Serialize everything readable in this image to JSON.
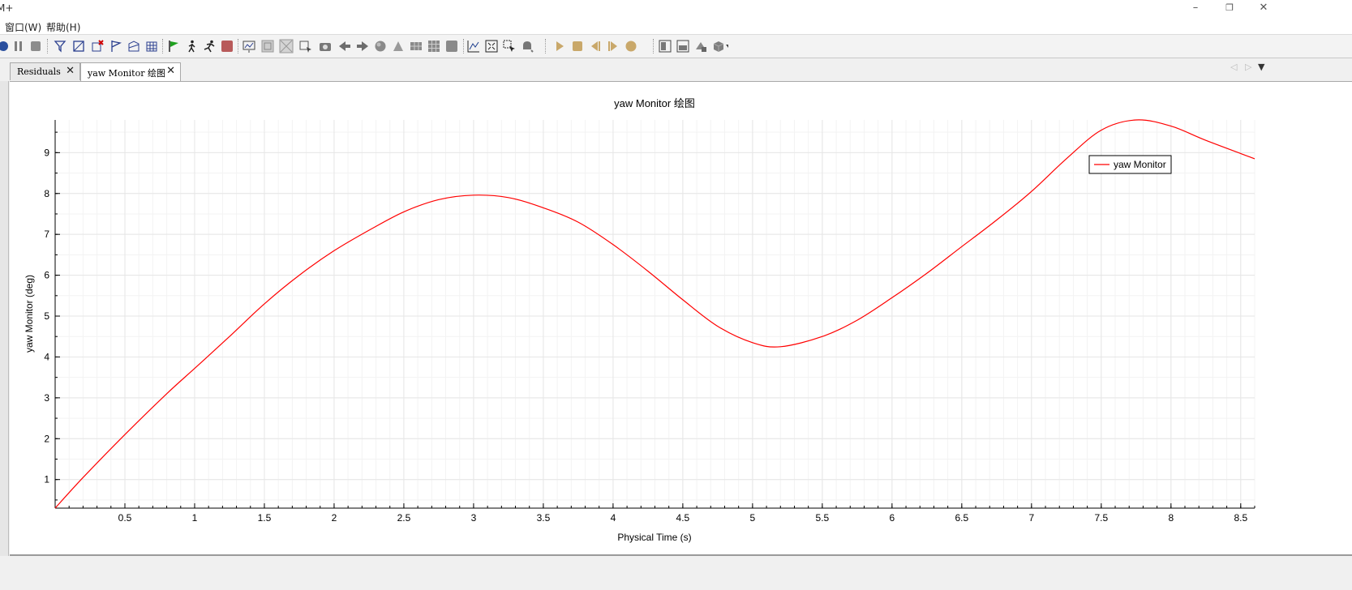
{
  "window": {
    "title": "M+",
    "minimize_label": "–",
    "restore_label": "❐",
    "close_label": "✕"
  },
  "menu": {
    "items": [
      {
        "label": "窗口(W)"
      },
      {
        "label": "帮助(H)"
      }
    ]
  },
  "toolbar": {
    "icons": [
      "record-icon",
      "pause-icon",
      "stop-icon",
      "filter-icon",
      "scene-icon",
      "delete-plot-icon",
      "flag-outline-icon",
      "plot-3d-icon",
      "mesh-icon",
      "run-flag-icon",
      "step-icon",
      "run-icon",
      "stop-run-icon",
      "image-icon",
      "grid-fit-icon",
      "zoom-icon",
      "select-icon",
      "camera-icon",
      "back-icon",
      "forward-icon",
      "sphere-icon",
      "probe-icon",
      "table-icon",
      "grid-icon",
      "box-icon",
      "plot-points-icon",
      "fit-icon",
      "cursor-icon",
      "bell-icon",
      "play-icon",
      "stop-anim-icon",
      "prev-frame-icon",
      "next-frame-icon",
      "record-anim-icon",
      "layout-icon",
      "layout2-icon",
      "view-icon",
      "cube-icon"
    ]
  },
  "tabs": [
    {
      "label": "Residuals",
      "close": "✕"
    },
    {
      "label": "yaw Monitor 绘图",
      "close": "✕"
    }
  ],
  "nav": {
    "left": "◁",
    "right": "▷",
    "menu": "▼"
  },
  "colors": {
    "series": "#ff0000",
    "grid": "#e6e6e6",
    "axis": "#000000"
  },
  "chart_data": {
    "type": "line",
    "title": "yaw Monitor 绘图",
    "xlabel": "Physical Time (s)",
    "ylabel": "yaw Monitor (deg)",
    "xlim": [
      0,
      8.6
    ],
    "ylim": [
      0.3,
      9.8
    ],
    "xticks": [
      0.5,
      1,
      1.5,
      2,
      2.5,
      3,
      3.5,
      4,
      4.5,
      5,
      5.5,
      6,
      6.5,
      7,
      7.5,
      8,
      8.5
    ],
    "xtick_labels": [
      "0.5",
      "1",
      "1.5",
      "2",
      "2.5",
      "3",
      "3.5",
      "4",
      "4.5",
      "5",
      "5.5",
      "6",
      "6.5",
      "7",
      "7.5",
      "8",
      "8.5"
    ],
    "yticks": [
      1,
      2,
      3,
      4,
      5,
      6,
      7,
      8,
      9
    ],
    "ytick_labels": [
      "1",
      "2",
      "3",
      "4",
      "5",
      "6",
      "7",
      "8",
      "9"
    ],
    "grid": true,
    "legend": {
      "position": "top-right",
      "entries": [
        "yaw Monitor"
      ]
    },
    "series": [
      {
        "name": "yaw Monitor",
        "color": "#ff0000",
        "x": [
          0.0,
          0.2,
          0.5,
          0.8,
          1.0,
          1.25,
          1.5,
          1.75,
          2.0,
          2.25,
          2.5,
          2.75,
          3.0,
          3.25,
          3.5,
          3.75,
          4.0,
          4.25,
          4.5,
          4.75,
          5.0,
          5.2,
          5.5,
          5.75,
          6.0,
          6.25,
          6.5,
          6.75,
          7.0,
          7.25,
          7.5,
          7.75,
          8.0,
          8.25,
          8.6
        ],
        "y": [
          0.3,
          1.05,
          2.1,
          3.1,
          3.72,
          4.5,
          5.3,
          6.0,
          6.6,
          7.1,
          7.55,
          7.85,
          7.96,
          7.9,
          7.65,
          7.3,
          6.75,
          6.1,
          5.4,
          4.75,
          4.35,
          4.25,
          4.5,
          4.9,
          5.45,
          6.05,
          6.7,
          7.35,
          8.05,
          8.85,
          9.55,
          9.8,
          9.65,
          9.3,
          8.85
        ]
      }
    ]
  }
}
